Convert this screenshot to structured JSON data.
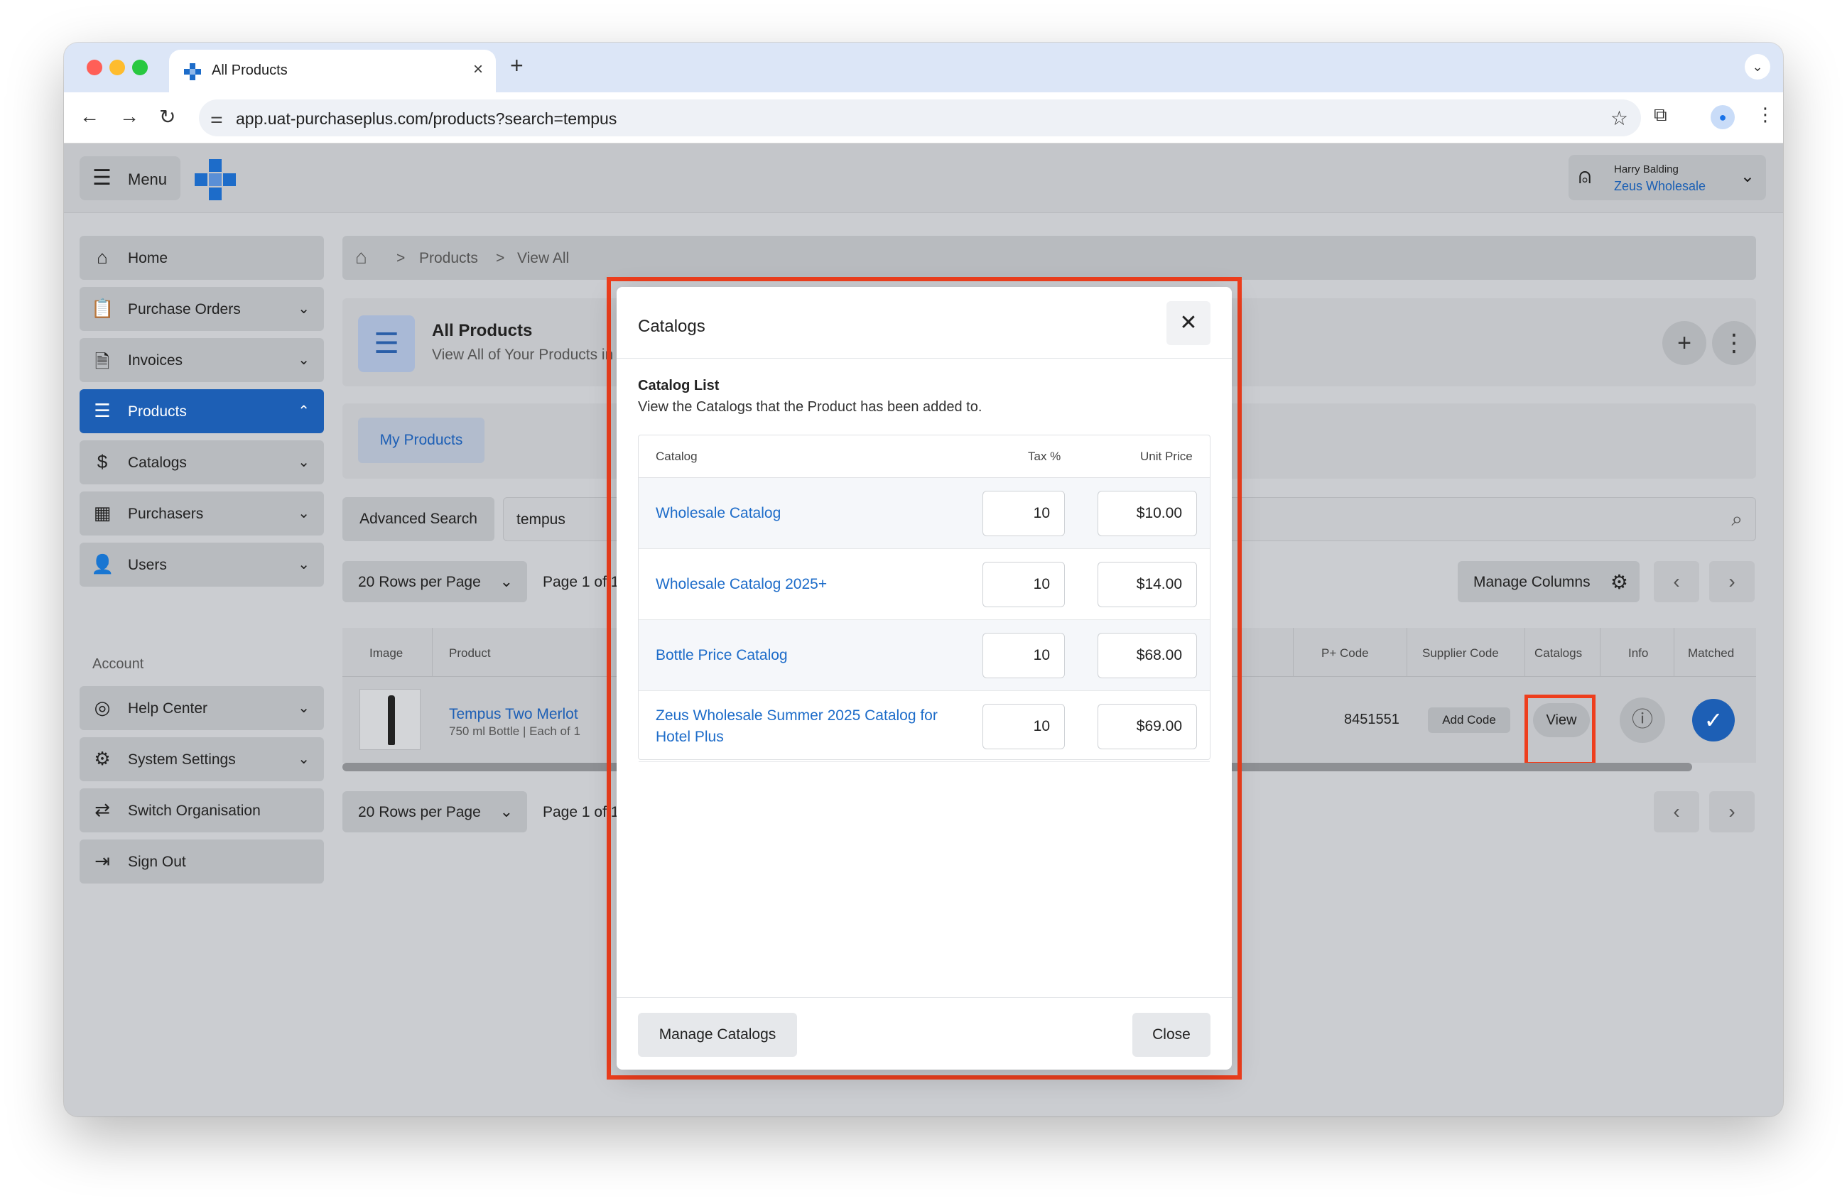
{
  "browser": {
    "tab_title": "All Products",
    "tab_close": "×",
    "new_tab": "+",
    "tab_menu": "⌄",
    "url": "app.uat-purchaseplus.com/products?search=tempus",
    "icons": [
      "back-icon",
      "forward-icon",
      "reload-icon",
      "site-settings-icon",
      "star-icon",
      "extensions-icon",
      "profile-icon",
      "more-icon"
    ]
  },
  "header": {
    "menu_label": "Menu",
    "user_name": "Harry Balding",
    "user_org": "Zeus Wholesale"
  },
  "sidebar": {
    "items": [
      {
        "label": "Home",
        "icon": "⌂",
        "chevron": ""
      },
      {
        "label": "Purchase Orders",
        "icon": "📋",
        "chevron": "⌄"
      },
      {
        "label": "Invoices",
        "icon": "🗎",
        "chevron": "⌄"
      },
      {
        "label": "Products",
        "icon": "☰",
        "chevron": "⌃"
      },
      {
        "label": "Catalogs",
        "icon": "$",
        "chevron": "⌄"
      },
      {
        "label": "Purchasers",
        "icon": "▦",
        "chevron": "⌄"
      },
      {
        "label": "Users",
        "icon": "👤",
        "chevron": "⌄"
      }
    ],
    "section_label": "Account",
    "account_items": [
      {
        "label": "Help Center",
        "icon": "◎",
        "chevron": "⌄"
      },
      {
        "label": "System Settings",
        "icon": "⚙",
        "chevron": "⌄"
      },
      {
        "label": "Switch Organisation",
        "icon": "⇄",
        "chevron": ""
      },
      {
        "label": "Sign Out",
        "icon": "⇥",
        "chevron": ""
      }
    ]
  },
  "breadcrumb": {
    "items": [
      "Products",
      "View All"
    ],
    "separator": ">"
  },
  "page": {
    "title": "All Products",
    "subtitle": "View All of Your Products in",
    "tab_my_products": "My Products",
    "advanced_search": "Advanced Search",
    "search_value": "tempus",
    "rows_per_page": "20 Rows per Page",
    "page_info": "Page 1 of 1",
    "manage_columns": "Manage Columns"
  },
  "table": {
    "headers": {
      "image": "Image",
      "product": "Product",
      "p_code": "P+ Code",
      "supplier_code": "Supplier Code",
      "catalogs": "Catalogs",
      "info": "Info",
      "matched": "Matched"
    },
    "row": {
      "product_name": "Tempus Two Merlot",
      "product_desc": "750 ml Bottle | Each of 1",
      "p_code": "8451551",
      "supplier_code_button": "Add Code",
      "catalogs_button": "View"
    }
  },
  "modal": {
    "title": "Catalogs",
    "list_title": "Catalog List",
    "list_desc": "View the Catalogs that the Product has been added to.",
    "col_catalog": "Catalog",
    "col_tax": "Tax %",
    "col_price": "Unit Price",
    "rows": [
      {
        "catalog": "Wholesale Catalog",
        "tax": "10",
        "price": "$10.00"
      },
      {
        "catalog": "Wholesale Catalog 2025+",
        "tax": "10",
        "price": "$14.00"
      },
      {
        "catalog": "Bottle Price Catalog",
        "tax": "10",
        "price": "$68.00"
      },
      {
        "catalog": "Zeus Wholesale Summer 2025 Catalog for Hotel Plus",
        "tax": "10",
        "price": "$69.00"
      }
    ],
    "manage_button": "Manage Catalogs",
    "close_button": "Close"
  },
  "colors": {
    "brand": "#1d5fb5",
    "highlight": "#ee3e1d",
    "link": "#1d6cc9"
  }
}
